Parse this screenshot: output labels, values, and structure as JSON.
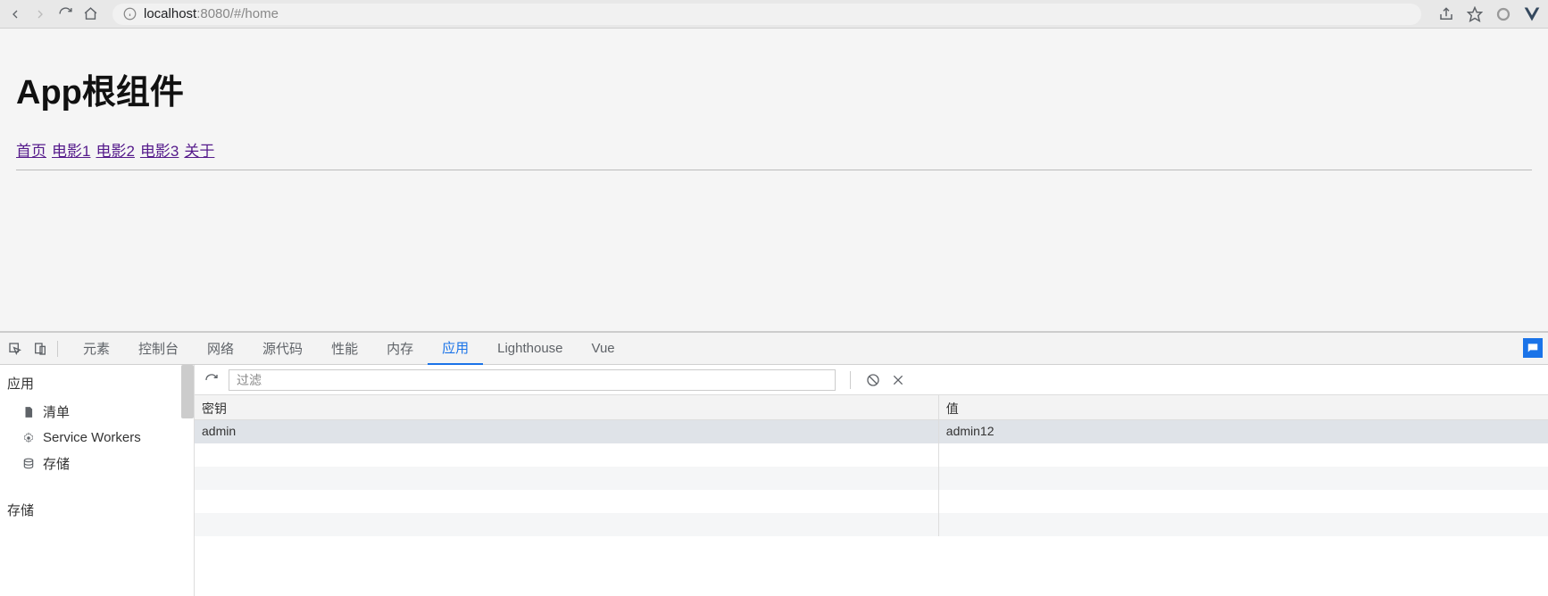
{
  "browser": {
    "url_host": "localhost",
    "url_port": ":8080",
    "url_path": "/#/home"
  },
  "page": {
    "title": "App根组件",
    "links": [
      "首页",
      "电影1",
      "电影2",
      "电影3",
      "关于"
    ]
  },
  "devtools": {
    "tabs": [
      "元素",
      "控制台",
      "网络",
      "源代码",
      "性能",
      "内存",
      "应用",
      "Lighthouse",
      "Vue"
    ],
    "active_tab": "应用",
    "sidebar": {
      "section1_title": "应用",
      "items1": [
        "清单",
        "Service Workers",
        "存储"
      ],
      "section2_title": "存储"
    },
    "toolbar": {
      "filter_placeholder": "过滤"
    },
    "table": {
      "header_key": "密钥",
      "header_value": "值",
      "rows": [
        {
          "key": "admin",
          "value": "admin12"
        }
      ]
    }
  }
}
